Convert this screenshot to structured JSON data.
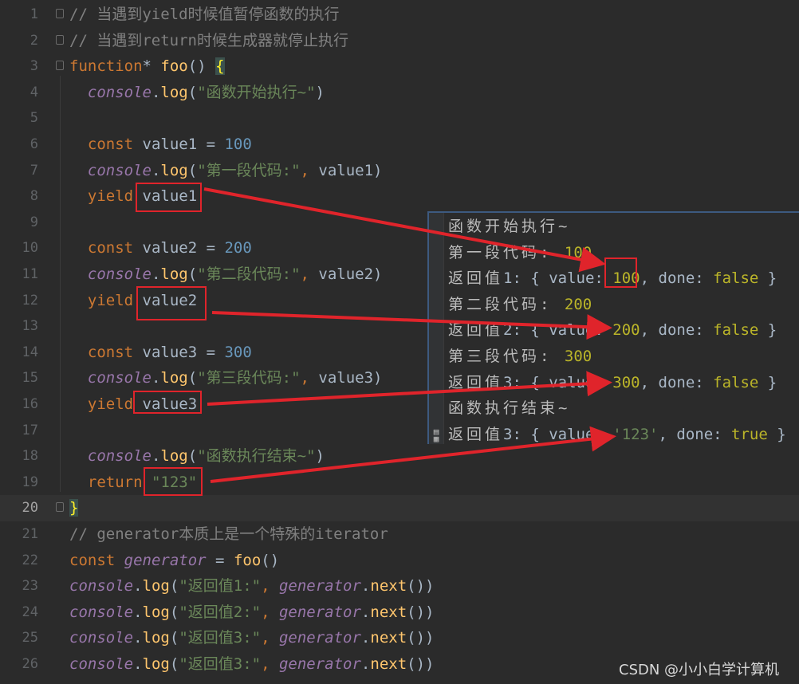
{
  "editor": {
    "current_line": "20",
    "lines": [
      {
        "n": "1",
        "t": [
          [
            "cmt",
            "// 当遇到yield时候值暂停函数的执行"
          ]
        ]
      },
      {
        "n": "2",
        "t": [
          [
            "cmt",
            "// 当遇到return时候生成器就停止执行"
          ]
        ]
      },
      {
        "n": "3",
        "t": [
          [
            "kw",
            "function"
          ],
          [
            "plain",
            "* "
          ],
          [
            "fn",
            "foo"
          ],
          [
            "plain",
            "() "
          ],
          [
            "brace-hl",
            "{"
          ]
        ]
      },
      {
        "n": "4",
        "t": [
          [
            "plain",
            "  "
          ],
          [
            "con",
            "console"
          ],
          [
            "plain",
            "."
          ],
          [
            "mth",
            "log"
          ],
          [
            "plain",
            "("
          ],
          [
            "str",
            "\"函数开始执行~\""
          ],
          [
            "plain",
            ")"
          ]
        ]
      },
      {
        "n": "5",
        "t": []
      },
      {
        "n": "6",
        "t": [
          [
            "plain",
            "  "
          ],
          [
            "kw",
            "const"
          ],
          [
            "plain",
            " value1 = "
          ],
          [
            "num",
            "100"
          ]
        ]
      },
      {
        "n": "7",
        "t": [
          [
            "plain",
            "  "
          ],
          [
            "con",
            "console"
          ],
          [
            "plain",
            "."
          ],
          [
            "mth",
            "log"
          ],
          [
            "plain",
            "("
          ],
          [
            "str",
            "\"第一段代码:\""
          ],
          [
            "kw",
            ", "
          ],
          [
            "plain",
            "value1)"
          ]
        ]
      },
      {
        "n": "8",
        "t": [
          [
            "plain",
            "  "
          ],
          [
            "kw",
            "yield"
          ],
          [
            "plain",
            " value1"
          ]
        ]
      },
      {
        "n": "9",
        "t": []
      },
      {
        "n": "10",
        "t": [
          [
            "plain",
            "  "
          ],
          [
            "kw",
            "const"
          ],
          [
            "plain",
            " value2 = "
          ],
          [
            "num",
            "200"
          ]
        ]
      },
      {
        "n": "11",
        "t": [
          [
            "plain",
            "  "
          ],
          [
            "con",
            "console"
          ],
          [
            "plain",
            "."
          ],
          [
            "mth",
            "log"
          ],
          [
            "plain",
            "("
          ],
          [
            "str",
            "\"第二段代码:\""
          ],
          [
            "kw",
            ", "
          ],
          [
            "plain",
            "value2)"
          ]
        ]
      },
      {
        "n": "12",
        "t": [
          [
            "plain",
            "  "
          ],
          [
            "kw",
            "yield"
          ],
          [
            "plain",
            " value2"
          ]
        ]
      },
      {
        "n": "13",
        "t": []
      },
      {
        "n": "14",
        "t": [
          [
            "plain",
            "  "
          ],
          [
            "kw",
            "const"
          ],
          [
            "plain",
            " value3 = "
          ],
          [
            "num",
            "300"
          ]
        ]
      },
      {
        "n": "15",
        "t": [
          [
            "plain",
            "  "
          ],
          [
            "con",
            "console"
          ],
          [
            "plain",
            "."
          ],
          [
            "mth",
            "log"
          ],
          [
            "plain",
            "("
          ],
          [
            "str",
            "\"第三段代码:\""
          ],
          [
            "kw",
            ", "
          ],
          [
            "plain",
            "value3)"
          ]
        ]
      },
      {
        "n": "16",
        "t": [
          [
            "plain",
            "  "
          ],
          [
            "kw",
            "yield"
          ],
          [
            "plain",
            " value3"
          ]
        ]
      },
      {
        "n": "17",
        "t": []
      },
      {
        "n": "18",
        "t": [
          [
            "plain",
            "  "
          ],
          [
            "con",
            "console"
          ],
          [
            "plain",
            "."
          ],
          [
            "mth",
            "log"
          ],
          [
            "plain",
            "("
          ],
          [
            "str",
            "\"函数执行结束~\""
          ],
          [
            "plain",
            ")"
          ]
        ]
      },
      {
        "n": "19",
        "t": [
          [
            "plain",
            "  "
          ],
          [
            "kw",
            "return"
          ],
          [
            "plain",
            " "
          ],
          [
            "str",
            "\"123\""
          ]
        ]
      },
      {
        "n": "20",
        "t": [
          [
            "brace-hl",
            "}"
          ]
        ]
      },
      {
        "n": "21",
        "t": [
          [
            "cmt",
            "// generator本质上是一个特殊的iterator"
          ]
        ]
      },
      {
        "n": "22",
        "t": [
          [
            "kw",
            "const"
          ],
          [
            "plain",
            " "
          ],
          [
            "con",
            "generator"
          ],
          [
            "plain",
            " = "
          ],
          [
            "fn",
            "foo"
          ],
          [
            "plain",
            "()"
          ]
        ]
      },
      {
        "n": "23",
        "t": [
          [
            "con",
            "console"
          ],
          [
            "plain",
            "."
          ],
          [
            "mth",
            "log"
          ],
          [
            "plain",
            "("
          ],
          [
            "str",
            "\"返回值1:\""
          ],
          [
            "kw",
            ", "
          ],
          [
            "con",
            "generator"
          ],
          [
            "plain",
            "."
          ],
          [
            "mth",
            "next"
          ],
          [
            "plain",
            "())"
          ]
        ]
      },
      {
        "n": "24",
        "t": [
          [
            "con",
            "console"
          ],
          [
            "plain",
            "."
          ],
          [
            "mth",
            "log"
          ],
          [
            "plain",
            "("
          ],
          [
            "str",
            "\"返回值2:\""
          ],
          [
            "kw",
            ", "
          ],
          [
            "con",
            "generator"
          ],
          [
            "plain",
            "."
          ],
          [
            "mth",
            "next"
          ],
          [
            "plain",
            "())"
          ]
        ]
      },
      {
        "n": "25",
        "t": [
          [
            "con",
            "console"
          ],
          [
            "plain",
            "."
          ],
          [
            "mth",
            "log"
          ],
          [
            "plain",
            "("
          ],
          [
            "str",
            "\"返回值3:\""
          ],
          [
            "kw",
            ", "
          ],
          [
            "con",
            "generator"
          ],
          [
            "plain",
            "."
          ],
          [
            "mth",
            "next"
          ],
          [
            "plain",
            "())"
          ]
        ]
      },
      {
        "n": "26",
        "t": [
          [
            "con",
            "console"
          ],
          [
            "plain",
            "."
          ],
          [
            "mth",
            "log"
          ],
          [
            "plain",
            "("
          ],
          [
            "str",
            "\"返回值3:\""
          ],
          [
            "kw",
            ", "
          ],
          [
            "con",
            "generator"
          ],
          [
            "plain",
            "."
          ],
          [
            "mth",
            "next"
          ],
          [
            "plain",
            "())"
          ]
        ]
      }
    ]
  },
  "console": {
    "icon": "console-tool-icon",
    "lines": [
      [
        [
          "ctx",
          "函数开始执行~"
        ]
      ],
      [
        [
          "ctx",
          "第一段代码: "
        ],
        [
          "cn",
          "100"
        ]
      ],
      [
        [
          "ctx",
          "返回值"
        ],
        [
          "plain",
          "1: { value: "
        ],
        [
          "cn",
          "100"
        ],
        [
          "plain",
          ", done: "
        ],
        [
          "ck",
          "false"
        ],
        [
          "plain",
          " }"
        ]
      ],
      [
        [
          "ctx",
          "第二段代码: "
        ],
        [
          "cn",
          "200"
        ]
      ],
      [
        [
          "ctx",
          "返回值"
        ],
        [
          "plain",
          "2: { value: "
        ],
        [
          "cn",
          "200"
        ],
        [
          "plain",
          ", done: "
        ],
        [
          "ck",
          "false"
        ],
        [
          "plain",
          " }"
        ]
      ],
      [
        [
          "ctx",
          "第三段代码: "
        ],
        [
          "cn",
          "300"
        ]
      ],
      [
        [
          "ctx",
          "返回值"
        ],
        [
          "plain",
          "3: { value: "
        ],
        [
          "cn",
          "300"
        ],
        [
          "plain",
          ", done: "
        ],
        [
          "ck",
          "false"
        ],
        [
          "plain",
          " }"
        ]
      ],
      [
        [
          "ctx",
          "函数执行结束~"
        ]
      ],
      [
        [
          "ctx",
          "返回值"
        ],
        [
          "plain",
          "3: { value: "
        ],
        [
          "cs",
          "'123'"
        ],
        [
          "plain",
          ", done: "
        ],
        [
          "ck",
          "true"
        ],
        [
          "plain",
          " }"
        ]
      ]
    ]
  },
  "annotation_color": "#e0242b",
  "watermark": "CSDN @小小白学计算机"
}
